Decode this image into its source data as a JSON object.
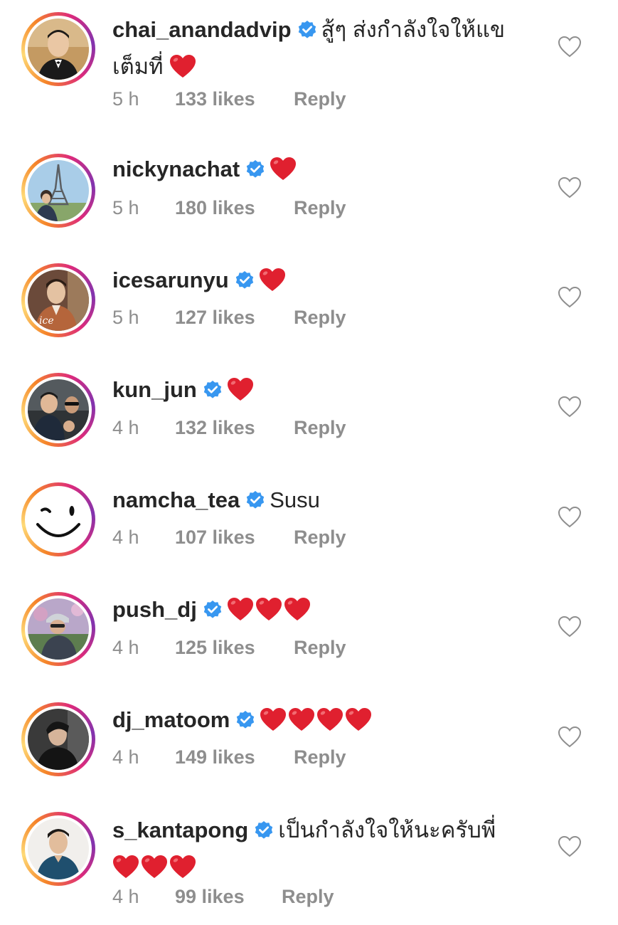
{
  "comments": [
    {
      "username": "chai_anandadvip",
      "text_line1": "สู้ๆ ส่งกำลังใจให้แข",
      "text_line2": "เต็มที่",
      "hearts": 1,
      "time": "5 h",
      "likes": "133 likes",
      "reply": "Reply"
    },
    {
      "username": "nickynachat",
      "text_line1": "",
      "hearts": 1,
      "time": "5 h",
      "likes": "180 likes",
      "reply": "Reply"
    },
    {
      "username": "icesarunyu",
      "text_line1": "",
      "hearts": 1,
      "time": "5 h",
      "likes": "127 likes",
      "reply": "Reply"
    },
    {
      "username": "kun_jun",
      "text_line1": "",
      "hearts": 1,
      "time": "4 h",
      "likes": "132 likes",
      "reply": "Reply"
    },
    {
      "username": "namcha_tea",
      "text_line1": "Susu",
      "hearts": 0,
      "time": "4 h",
      "likes": "107 likes",
      "reply": "Reply"
    },
    {
      "username": "push_dj",
      "text_line1": "",
      "hearts": 3,
      "time": "4 h",
      "likes": "125 likes",
      "reply": "Reply"
    },
    {
      "username": "dj_matoom",
      "text_line1": "",
      "hearts": 4,
      "time": "4 h",
      "likes": "149 likes",
      "reply": "Reply"
    },
    {
      "username": "s_kantapong",
      "text_line1": "เป็นกำลังใจให้นะครับพี่",
      "text_line2": "",
      "hearts": 3,
      "time": "4 h",
      "likes": "99 likes",
      "reply": "Reply"
    }
  ],
  "icons": {
    "verified": "verified-badge-icon",
    "heart_emoji": "red-heart-emoji",
    "like": "heart-outline-icon"
  },
  "colors": {
    "verified_blue": "#3897f0",
    "heart_red": "#e0202f",
    "meta_gray": "#8e8e8e",
    "text": "#262626"
  }
}
